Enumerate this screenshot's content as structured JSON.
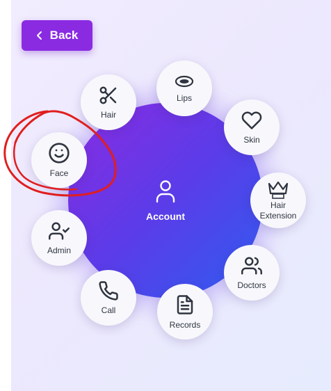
{
  "back_button": {
    "label": "Back",
    "icon": "chevron-left-icon"
  },
  "hub": {
    "label": "Account",
    "icon": "user-icon"
  },
  "nodes": {
    "hair": {
      "label": "Hair",
      "icon": "scissors-icon"
    },
    "lips": {
      "label": "Lips",
      "icon": "lips-icon"
    },
    "skin": {
      "label": "Skin",
      "icon": "heart-icon"
    },
    "hair_extension": {
      "label": "Hair Extension",
      "icon": "crown-icon"
    },
    "doctors": {
      "label": "Doctors",
      "icon": "users-icon"
    },
    "records": {
      "label": "Records",
      "icon": "file-text-icon"
    },
    "call": {
      "label": "Call",
      "icon": "phone-icon"
    },
    "admin": {
      "label": "Admin",
      "icon": "user-check-icon"
    },
    "face": {
      "label": "Face",
      "icon": "smile-icon"
    }
  },
  "colors": {
    "accent_purple": "#8a2be2",
    "accent_blue": "#2f5cf0",
    "annotation_red": "#e01e1e"
  }
}
